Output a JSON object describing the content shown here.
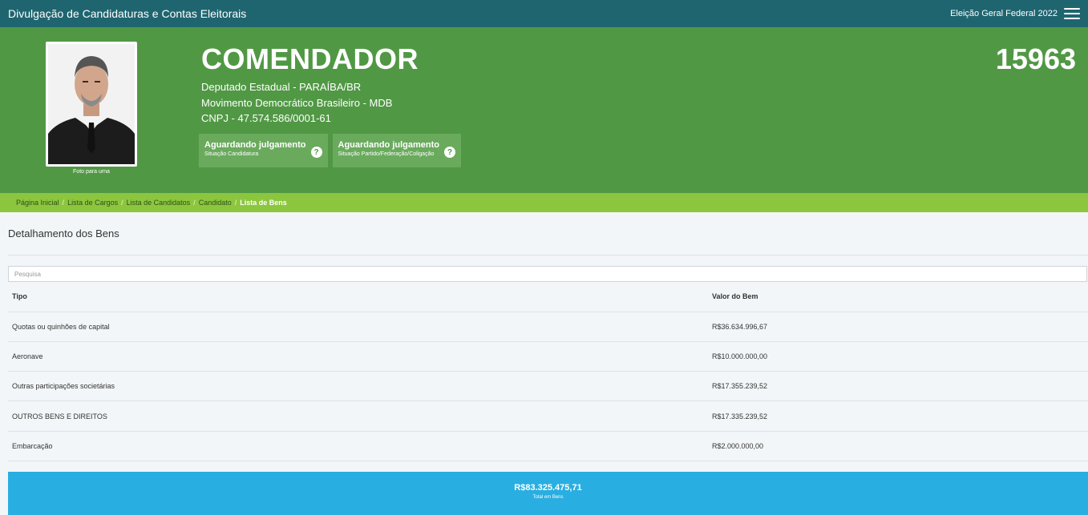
{
  "header": {
    "app_title": "Divulgação de Candidaturas e Contas Eleitorais",
    "election": "Eleição Geral Federal 2022",
    "menu_icon": "hamburger-menu-icon"
  },
  "candidate": {
    "photo_caption": "Foto para urna",
    "name": "COMENDADOR",
    "number": "15963",
    "position": "Deputado Estadual - PARAÍBA/BR",
    "party": "Movimento Democrático Brasileiro - MDB",
    "cnpj": "CNPJ - 47.574.586/0001-61",
    "badges": [
      {
        "title": "Aguardando julgamento",
        "subtitle": "Situação Candidatura",
        "icon": "help-icon"
      },
      {
        "title": "Aguardando julgamento",
        "subtitle": "Situação Partido/Federação/Coligação",
        "icon": "help-icon"
      }
    ]
  },
  "breadcrumb": {
    "items": [
      "Página Inicial",
      "Lista de Cargos",
      "Lista de Candidatos",
      "Candidato"
    ],
    "current": "Lista de Bens",
    "separator": "/"
  },
  "main": {
    "section_title": "Detalhamento dos Bens",
    "search_placeholder": "Pesquisa",
    "table": {
      "headers": [
        "Tipo",
        "Valor do Bem"
      ],
      "rows": [
        [
          "Quotas ou quinhões de capital",
          "R$36.634.996,67"
        ],
        [
          "Aeronave",
          "R$10.000.000,00"
        ],
        [
          "Outras participações societárias",
          "R$17.355.239,52"
        ],
        [
          "OUTROS BENS E DIREITOS",
          "R$17.335.239,52"
        ],
        [
          "Embarcação",
          "R$2.000.000,00"
        ]
      ]
    },
    "total": {
      "value": "R$83.325.475,71",
      "label": "Total em Bens"
    }
  },
  "colors": {
    "topbar": "#1f6570",
    "hero": "#519845",
    "breadcrumb": "#8cc63e",
    "total_bar": "#29aee1"
  }
}
